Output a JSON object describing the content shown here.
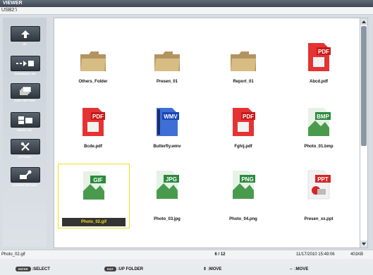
{
  "title": "VIEWER",
  "path": "USB2:\\",
  "sidebar": {
    "buttons": [
      {
        "label": "UP"
      },
      {
        "label": "THUMBNAIL ON"
      },
      {
        "label": "SORT SETTING"
      },
      {
        "label": "DRIVE LIST"
      },
      {
        "label": "OPTIONS"
      },
      {
        "label": "SYSTEM SETTING"
      }
    ]
  },
  "files": [
    {
      "name": "Others_Folder",
      "type": "folder"
    },
    {
      "name": "Presen_01",
      "type": "folder"
    },
    {
      "name": "Report_01",
      "type": "folder"
    },
    {
      "name": "Abcd.pdf",
      "type": "PDF"
    },
    {
      "name": "Bcde.pdf",
      "type": "PDF"
    },
    {
      "name": "Butterfly.wmv",
      "type": "WMV"
    },
    {
      "name": "Fghij.pdf",
      "type": "PDF"
    },
    {
      "name": "Photo_01.bmp",
      "type": "BMP"
    },
    {
      "name": "Photo_02.gif",
      "type": "GIF",
      "selected": true
    },
    {
      "name": "Photo_03.jpg",
      "type": "JPG"
    },
    {
      "name": "Photo_04.png",
      "type": "PNG"
    },
    {
      "name": "Presen_xx.ppt",
      "type": "PPT"
    }
  ],
  "status": {
    "selected_file": "Photo_02.gif",
    "page": "6 / 12",
    "datetime": "11/17/2010 15:49:06",
    "size": "401KB"
  },
  "hints": {
    "enter_key": "ENTER",
    "enter_label": ":SELECT",
    "exit_key": "EXIT",
    "exit_label": ":UP FOLDER",
    "updown_label": ":MOVE",
    "leftright_label": ":MOVE"
  },
  "colors": {
    "selection": "#f1df19",
    "pdf": "#d72525",
    "wmv": "#1a45b8",
    "image": "#2b8a3e",
    "ppt": "#d72525"
  }
}
